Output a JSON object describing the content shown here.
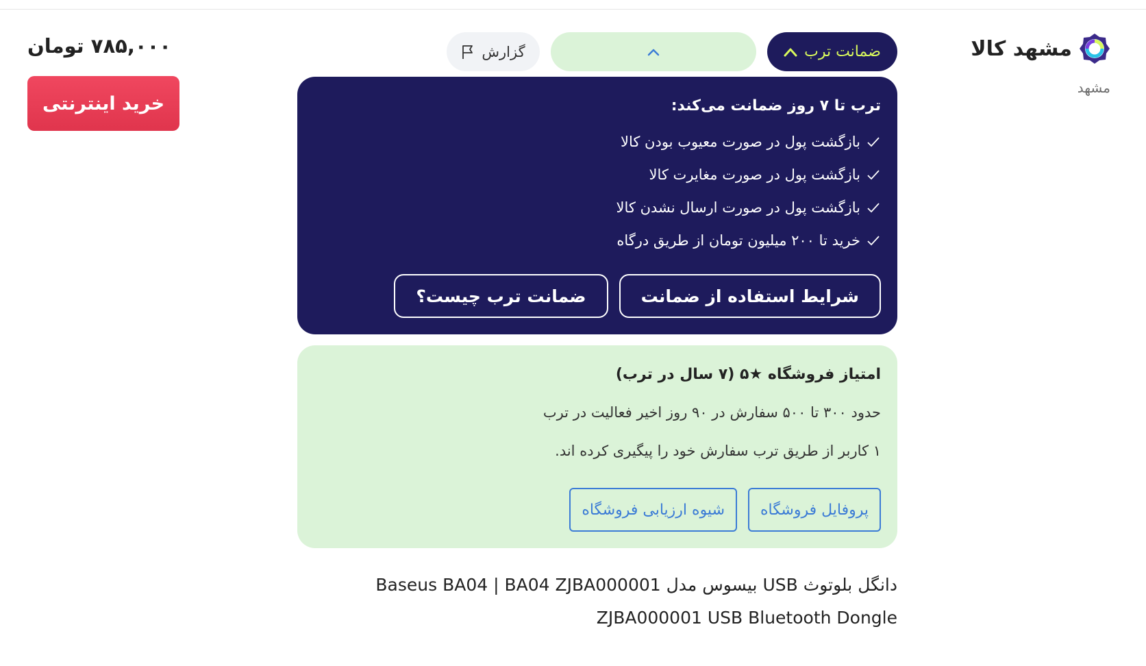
{
  "seller": {
    "name": "مشهد کالا",
    "city": "مشهد"
  },
  "price": {
    "amount": "۷۸۵,۰۰۰ تومان",
    "buy_label": "خرید اینترنتی"
  },
  "pills": {
    "guarantee_label": "ضمانت ترب",
    "report_label": "گزارش"
  },
  "guarantee": {
    "title": "ترب تا ۷ روز ضمانت می‌کند:",
    "items": [
      "بازگشت پول در صورت معیوب بودن کالا",
      "بازگشت پول در صورت مغایرت کالا",
      "بازگشت پول در صورت ارسال نشدن کالا",
      "خرید تا ۲۰۰ میلیون تومان از طریق درگاه"
    ],
    "terms_button": "شرایط استفاده از ضمانت",
    "what_button": "ضمانت ترب چیست؟"
  },
  "score": {
    "title": "امتیاز فروشگاه ★۵ (۷ سال در ترب)",
    "orders_line": "حدود ۳۰۰ تا ۵۰۰ سفارش در ۹۰ روز اخیر فعالیت در ترب",
    "tracking_line": "۱ کاربر از طریق ترب سفارش خود را پیگیری کرده اند.",
    "profile_button": "پروفایل فروشگاه",
    "method_button": "شیوه ارزیابی فروشگاه"
  },
  "product": {
    "title": "دانگل بلوتوث USB بیسوس مدل Baseus BA04 | BA04 ZJBA000001 ZJBA000001 USB Bluetooth Dongle"
  },
  "colors": {
    "navy": "#1e1b5c",
    "lime": "#d9f95c",
    "mint": "#dbf3d8",
    "blue": "#3b7bd6",
    "red": "#e63e55"
  }
}
